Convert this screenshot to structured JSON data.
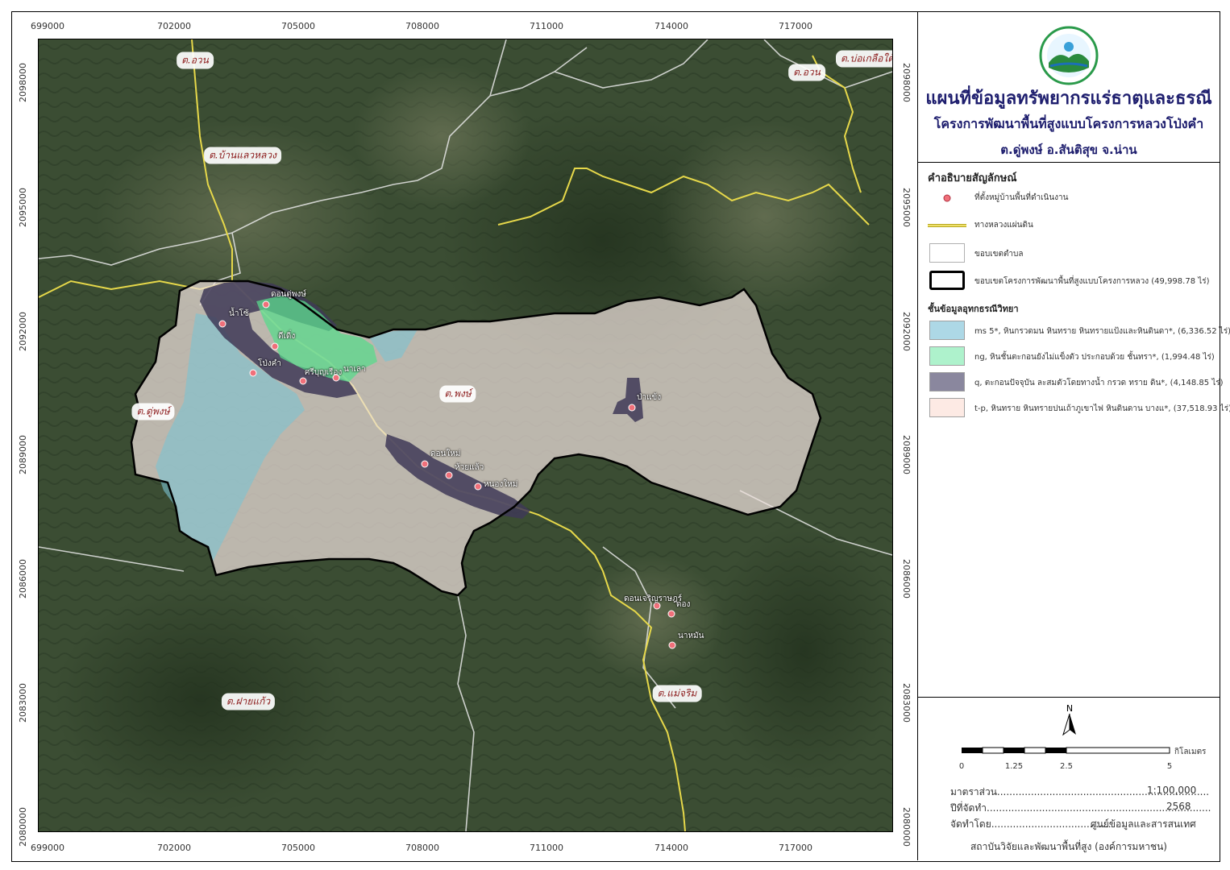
{
  "coords": {
    "x_ticks": [
      "699000",
      "702000",
      "705000",
      "708000",
      "711000",
      "714000",
      "717000"
    ],
    "y_ticks": [
      "2098000",
      "2095000",
      "2092000",
      "2089000",
      "2086000",
      "2083000",
      "2080000"
    ]
  },
  "title_block": {
    "title": "แผนที่ข้อมูลทรัพยากรแร่ธาตุและธรณี",
    "subtitle1": "โครงการพัฒนาพื้นที่สูงแบบโครงการหลวงโป่งคำ",
    "subtitle2": "ต.ดู่พงษ์ อ.สันติสุข จ.น่าน"
  },
  "legend": {
    "heading": "คำอธิบายสัญลักษณ์",
    "items": [
      {
        "label": "ที่ตั้งหมู่บ้านพื้นที่ดำเนินงาน",
        "symbol": "village-point",
        "color": "#f0707a"
      },
      {
        "label": "ทางหลวงแผ่นดิน",
        "symbol": "highway-line",
        "color": "#e6d84a"
      },
      {
        "label": "ขอบเขตตำบล",
        "symbol": "subdistrict-boundary",
        "color": "#ffffff"
      },
      {
        "label": "ขอบเขตโครงการพัฒนาพื้นที่สูงแบบโครงการหลวง (49,998.78 ไร่)",
        "symbol": "project-boundary",
        "color": "#000000"
      }
    ],
    "geology_heading": "ชั้นข้อมูลอุทกธรณีวิทยา",
    "geology_units": [
      {
        "label": "ms 5*, หินกรวดมน หินทราย หินทรายแป้งและหินดินดา*, (6,336.52 ไร่)",
        "color": "#add8e6"
      },
      {
        "label": "ng, หินชั้นตะกอนยังไม่แข็งตัว ประกอบด้วย ชั้นทรา*, (1,994.48 ไร่)",
        "color": "#aef2cc"
      },
      {
        "label": "q, ตะกอนปัจจุบัน ละสมตัวโดยทางน้ำ กรวด ทราย ดิน*, (4,148.85 ไร่)",
        "color": "#8a879e"
      },
      {
        "label": "t-p, หินทราย หินทรายปนเถ้าภูเขาไฟ หินดินดาน บางแ*, (37,518.93 ไร่)",
        "color": "#fdeae4"
      }
    ]
  },
  "north_label": "N",
  "scale_bar": {
    "ticks": [
      "0",
      "1.25",
      "2.5",
      "5"
    ],
    "unit": "กิโลเมตร"
  },
  "info": {
    "scale_label": "มาตราส่วน.....................................................................",
    "scale_value": "1:100,000",
    "year_label": "ปีที่จัดทำ.........................................................................",
    "year_value": "2568",
    "made_by_label": "จัดทำโดย.......................................",
    "made_by_value": "ศูนย์ข้อมูลและสารสนเทศ",
    "footer": "สถาบันวิจัยและพัฒนาพื้นที่สูง (องค์การมหาชน)"
  },
  "places": [
    {
      "name": "ต.อวน",
      "id": "auan-west"
    },
    {
      "name": "ต.อวน",
      "id": "auan-east"
    },
    {
      "name": "ต.บ่อเกลือใต้",
      "id": "bokluea-tai"
    },
    {
      "name": "ต.บ้านแลวหลวง",
      "id": "ban-laeo-luang"
    },
    {
      "name": "ต.ดู่พงษ์",
      "id": "du-phong"
    },
    {
      "name": "ต.พงษ์",
      "id": "phong"
    },
    {
      "name": "ต.ฝายแก้ว",
      "id": "fai-kaeo"
    },
    {
      "name": "ต.แม่จริม",
      "id": "mae-charim"
    }
  ],
  "villages": [
    {
      "name": "ดอนดู่พงษ์"
    },
    {
      "name": "น้ำโซ้"
    },
    {
      "name": "ดีเดิ่ง"
    },
    {
      "name": "โป่งคำ"
    },
    {
      "name": "ศรีบุญเรือง"
    },
    {
      "name": "นาเลา"
    },
    {
      "name": "ดอนใหม่"
    },
    {
      "name": "ห้วยแล้ว"
    },
    {
      "name": "หนองใหม่"
    },
    {
      "name": "ป่าแข้ง"
    },
    {
      "name": "ดอนเจริญราษฎร์"
    },
    {
      "name": "ดอง"
    },
    {
      "name": "นาหมัน"
    }
  ]
}
